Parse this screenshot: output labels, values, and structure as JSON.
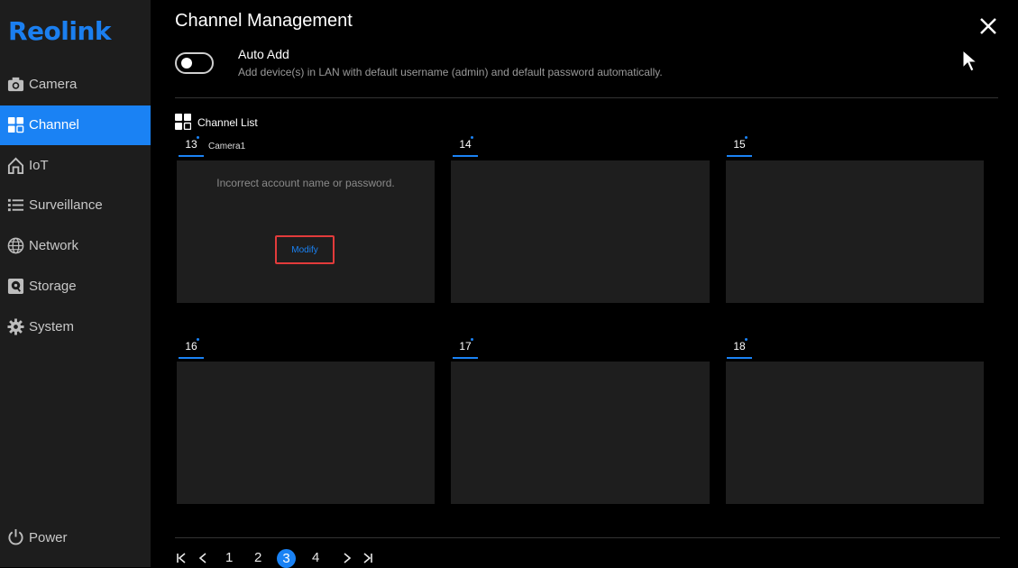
{
  "brand": {
    "logo_text": "Reolink",
    "accent": "#1a82f4"
  },
  "sidebar": {
    "items": [
      {
        "label": "Camera",
        "icon": "camera-icon"
      },
      {
        "label": "Channel",
        "icon": "channel-grid-icon",
        "active": true
      },
      {
        "label": "IoT",
        "icon": "iot-home-icon"
      },
      {
        "label": "Surveillance",
        "icon": "list-icon"
      },
      {
        "label": "Network",
        "icon": "globe-icon"
      },
      {
        "label": "Storage",
        "icon": "storage-icon"
      },
      {
        "label": "System",
        "icon": "gear-icon"
      }
    ],
    "power_label": "Power"
  },
  "main": {
    "title": "Channel Management",
    "auto_add": {
      "title": "Auto Add",
      "description": "Add device(s) in LAN with default username (admin) and default password automatically.",
      "enabled": false
    },
    "channel_list_label": "Channel List",
    "channels": [
      {
        "number": "13",
        "name": "Camera1",
        "error": "Incorrect account name or password.",
        "action": "Modify"
      },
      {
        "number": "14",
        "name": ""
      },
      {
        "number": "15",
        "name": ""
      },
      {
        "number": "16",
        "name": ""
      },
      {
        "number": "17",
        "name": ""
      },
      {
        "number": "18",
        "name": ""
      }
    ]
  },
  "pagination": {
    "pages": [
      "1",
      "2",
      "3",
      "4"
    ],
    "current": "3"
  }
}
